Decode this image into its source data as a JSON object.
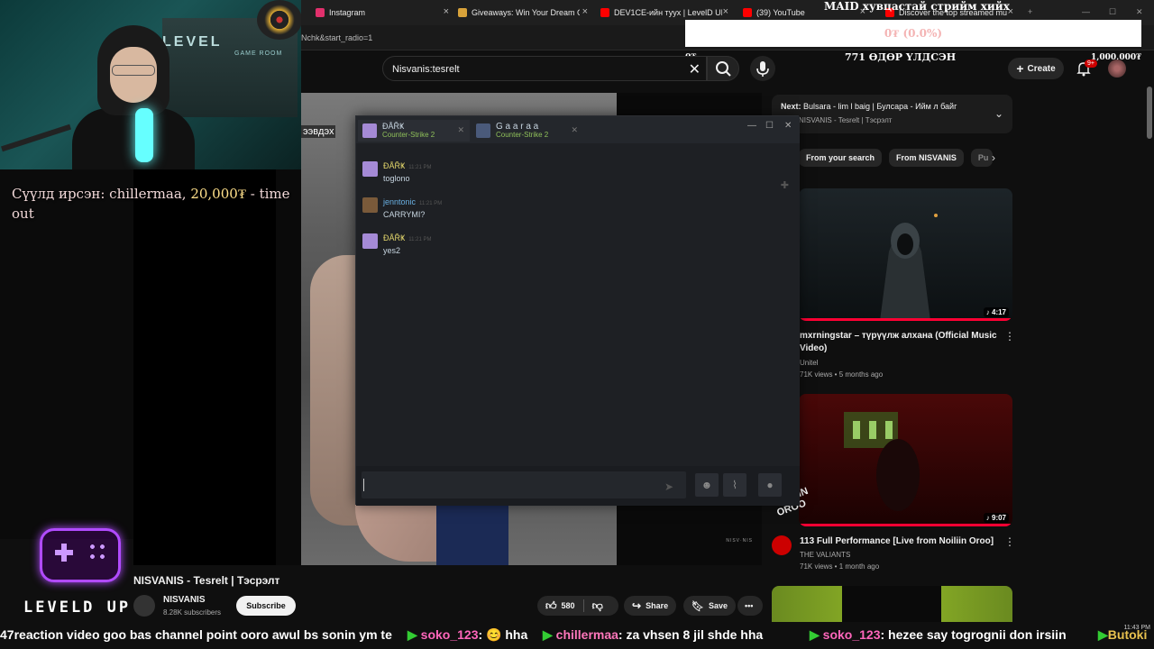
{
  "browser": {
    "tabs": [
      {
        "title": "Instagram",
        "color": "#e1306c"
      },
      {
        "title": "Giveaways: Win Your Dream CS",
        "color": "#d8a23a"
      },
      {
        "title": "DEV1CE-ийн тууx | LevelD UP",
        "color": "#ff0000"
      },
      {
        "title": "(39) YouTube",
        "color": "#ff0000"
      },
      {
        "title": "Discover the top streamed mu",
        "color": "#ff0000"
      }
    ],
    "url": "Nchk&start_radio=1"
  },
  "stream": {
    "sub_alert_prefix": "Сүүлд ирсэн: chillermaa, ",
    "sub_alert_amount": "20,000₮",
    "sub_alert_suffix": " - time out",
    "logo_text": "LEVELD UP",
    "webcam_sign": "LEVEL",
    "webcam_sub": "GAME ROOM"
  },
  "goal": {
    "title": "MAID хувцастай стрийм хийх",
    "percent_label": "0₮ (0.0%)",
    "percent_value": 0,
    "min_label": "0₮",
    "max_label": "1,000,000₮",
    "days_label": "771 ӨДӨР ҮЛДСЭН"
  },
  "youtube": {
    "search_value": "Nisvanis:tesrelt",
    "create_label": "Create",
    "notif_badge": "9+",
    "next": {
      "label": "Next:",
      "title": "Bulsara - lim l baig | Булсара - Ийм л байг",
      "channel": "NISVANIS - Tesrelt | Тэсрэлт"
    },
    "chips": [
      "From your search",
      "From NISVANIS",
      "Pu"
    ],
    "recommendations": [
      {
        "title": "mxrningstar – түрүүлж алхана (Official Music Video)",
        "channel": "Unitel",
        "meta": "71K views • 5 months ago",
        "duration": "♪ 4:17"
      },
      {
        "title": "113 Full Performance [Live from Noiliin Oroo]",
        "channel": "THE VALIANTS",
        "meta": "71K views • 1 month ago",
        "duration": "♪ 9:07",
        "overlay": "NOILIIN OROO"
      }
    ],
    "video_title": "NISVANIS - Tesrelt | Тэсрэлт",
    "channel_name": "NISVANIS",
    "channel_subs": "8.28K subscribers",
    "subscribe_label": "Subscribe",
    "likes": "580",
    "share_label": "Share",
    "save_label": "Save",
    "wall_text": "ээвдэх",
    "video_watermark": "NISV·NIS"
  },
  "steam": {
    "tabs": [
      {
        "name": "ĐÅŘҜ",
        "game": "Counter-Strike 2",
        "color": "#a58ad6"
      },
      {
        "name": "G a a r a a",
        "game": "Counter-Strike 2",
        "color": "#4a5a7a"
      }
    ],
    "messages": [
      {
        "author": "ĐÅŘҜ",
        "time": "11:21 PM",
        "text": "toglono",
        "color": "#a58ad6",
        "name_color": "#e3d66b"
      },
      {
        "author": "jenntonic",
        "time": "11:21 PM",
        "text": "CARRYMI?",
        "color": "#7a5a3a",
        "name_color": "#6ab0e2"
      },
      {
        "author": "ĐÅŘҜ",
        "time": "11:21 PM",
        "text": "yes2",
        "color": "#a58ad6",
        "name_color": "#e3d66b"
      }
    ]
  },
  "ticker": [
    {
      "prefix": "47",
      "text": "reaction video goo bas channel point ooro awul bs sonin ym te"
    },
    {
      "user": "soko_123",
      "text": ": 😊 hha"
    },
    {
      "user": "chillermaa",
      "text": ": za vhsen 8 jil shde hha"
    },
    {
      "user": "soko_123",
      "text": ": hezee say togrognii don irsiin"
    },
    {
      "user": "Butoki",
      "text": ""
    }
  ],
  "clock": {
    "time": "11:43 PM"
  }
}
